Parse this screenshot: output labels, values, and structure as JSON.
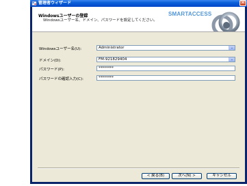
{
  "window": {
    "title": "管理者ウィザード",
    "close_glyph": "✕"
  },
  "header": {
    "title": "Windowsユーザーの登録",
    "subtitle": "Windowsユーザー名、ドメイン、パスワードを設定してください。",
    "brand": "SMARTACCESS"
  },
  "form": {
    "username_label": "Windowsユーザー名(U):",
    "username_value": "Administrator",
    "domain_label": "ドメイン(D):",
    "domain_value": "FM-921829404",
    "password_label": "パスワード(P):",
    "password_value": "********",
    "confirm_label": "パスワードの確認入力(C):",
    "confirm_value": "********",
    "combo_arrow": "⌄"
  },
  "buttons": {
    "back": "< 戻る(B)",
    "next": "次へ(N) >",
    "cancel": "キャンセル"
  },
  "colors": {
    "titlebar": "#0a5fd8",
    "brand": "#4f95d9",
    "dialog_bg": "#ece9d8"
  },
  "icons": [
    "app-icon",
    "close-icon",
    "smartaccess-logo",
    "dropdown-arrow-icon"
  ]
}
